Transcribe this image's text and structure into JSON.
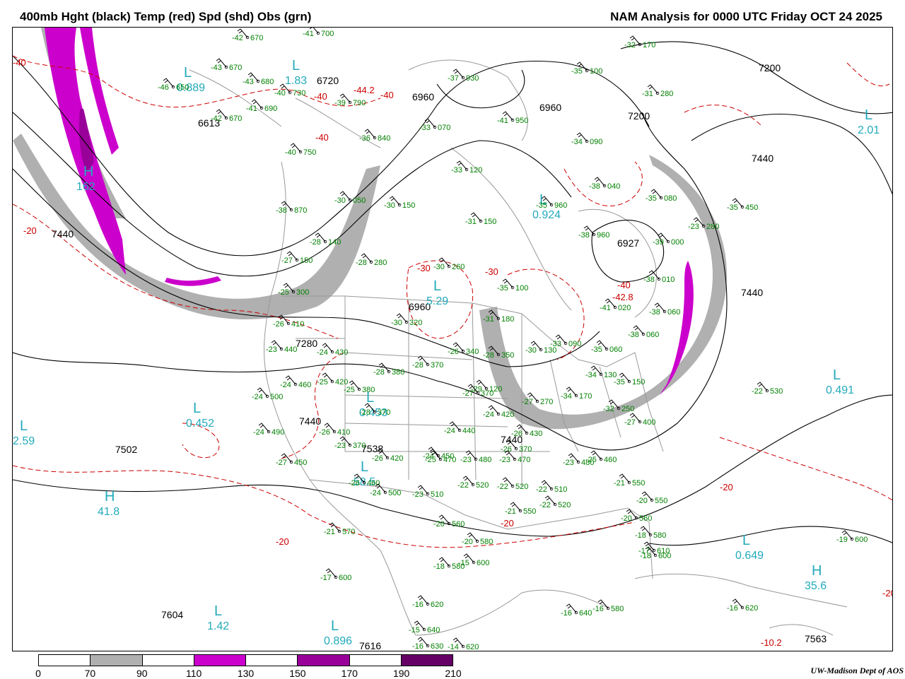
{
  "header": {
    "left_title": "400mb Hght (black) Temp (red) Spd (shd) Obs (grn)",
    "right_title": "NAM Analysis for 0000 UTC Friday  OCT 24 2025"
  },
  "colors": {
    "height": "#000000",
    "temp": "#cc0000",
    "obs": "#008000",
    "pressure_center": "#22aabb",
    "borders": "#999999"
  },
  "colorbar": {
    "labels": [
      "0",
      "70",
      "90",
      "110",
      "130",
      "150",
      "170",
      "190",
      "210"
    ],
    "colors": [
      "#ffffff",
      "#b0b0b0",
      "#ffffff",
      "#cc00cc",
      "#ffffff",
      "#990099",
      "#ffffff",
      "#660066"
    ]
  },
  "height_labels": [
    "7200",
    "7200",
    "7440",
    "7440",
    "7440",
    "7440",
    "6960",
    "6960",
    "6720",
    "6613",
    "6927",
    "6960",
    "7280",
    "7440",
    "7502",
    "7538",
    "7604",
    "7616",
    "7563",
    "7440"
  ],
  "temp_labels": [
    "-40",
    "-40",
    "-40",
    "-40",
    "-20",
    "-20",
    "-30",
    "-30",
    "-44.2",
    "-40",
    "-42.8",
    "-20",
    "-20",
    "-20",
    "-10.2"
  ],
  "centers": [
    {
      "type": "H",
      "value": "41.8"
    },
    {
      "type": "H",
      "value": "35.6"
    },
    {
      "type": "H",
      "value": "162"
    },
    {
      "type": "L",
      "value": "0.889"
    },
    {
      "type": "L",
      "value": "1.83"
    },
    {
      "type": "L",
      "value": "2.01"
    },
    {
      "type": "L",
      "value": "0.924"
    },
    {
      "type": "L",
      "value": "5.29"
    },
    {
      "type": "L",
      "value": "0.453"
    },
    {
      "type": "L",
      "value": "0.452"
    },
    {
      "type": "L",
      "value": "0.491"
    },
    {
      "type": "L",
      "value": "0.649"
    },
    {
      "type": "L",
      "value": "1.42"
    },
    {
      "type": "L",
      "value": "0.896"
    },
    {
      "type": "L",
      "value": "58.5"
    },
    {
      "type": "L",
      "value": "2.59"
    }
  ],
  "observations": [
    {
      "temp": "-42",
      "hght": "670"
    },
    {
      "temp": "-41",
      "hght": "700"
    },
    {
      "temp": "-43",
      "hght": "670"
    },
    {
      "temp": "-43",
      "hght": "680"
    },
    {
      "temp": "-46",
      "hght": "650"
    },
    {
      "temp": "-40",
      "hght": "730"
    },
    {
      "temp": "-41",
      "hght": "690"
    },
    {
      "temp": "-42",
      "hght": "670"
    },
    {
      "temp": "-39",
      "hght": "790"
    },
    {
      "temp": "-37",
      "hght": "930"
    },
    {
      "temp": "-35",
      "hght": "100"
    },
    {
      "temp": "-32",
      "hght": "170"
    },
    {
      "temp": "-31",
      "hght": "280"
    },
    {
      "temp": "-33",
      "hght": "070"
    },
    {
      "temp": "-41",
      "hght": "950"
    },
    {
      "temp": "-34",
      "hght": "090"
    },
    {
      "temp": "-36",
      "hght": "840"
    },
    {
      "temp": "-40",
      "hght": "750"
    },
    {
      "temp": "-33",
      "hght": "120"
    },
    {
      "temp": "-38",
      "hght": "040"
    },
    {
      "temp": "-35",
      "hght": "080"
    },
    {
      "temp": "-35",
      "hght": "450"
    },
    {
      "temp": "-30",
      "hght": "050"
    },
    {
      "temp": "-38",
      "hght": "870"
    },
    {
      "temp": "-30",
      "hght": "150"
    },
    {
      "temp": "-35",
      "hght": "960"
    },
    {
      "temp": "-31",
      "hght": "150"
    },
    {
      "temp": "-38",
      "hght": "960"
    },
    {
      "temp": "-39",
      "hght": "000"
    },
    {
      "temp": "-23",
      "hght": "280"
    },
    {
      "temp": "-28",
      "hght": "140"
    },
    {
      "temp": "-28",
      "hght": "280"
    },
    {
      "temp": "-27",
      "hght": "150"
    },
    {
      "temp": "-30",
      "hght": "260"
    },
    {
      "temp": "-35",
      "hght": "100"
    },
    {
      "temp": "-38",
      "hght": "010"
    },
    {
      "temp": "-25",
      "hght": "300"
    },
    {
      "temp": "-41",
      "hght": "020"
    },
    {
      "temp": "-38",
      "hght": "060"
    },
    {
      "temp": "-26",
      "hght": "410"
    },
    {
      "temp": "-30",
      "hght": "320"
    },
    {
      "temp": "-31",
      "hght": "180"
    },
    {
      "temp": "-38",
      "hght": "060"
    },
    {
      "temp": "-23",
      "hght": "440"
    },
    {
      "temp": "-24",
      "hght": "430"
    },
    {
      "temp": "-26",
      "hght": "340"
    },
    {
      "temp": "-28",
      "hght": "350"
    },
    {
      "temp": "-30",
      "hght": "130"
    },
    {
      "temp": "-33",
      "hght": "090"
    },
    {
      "temp": "-35",
      "hght": "060"
    },
    {
      "temp": "-28",
      "hght": "370"
    },
    {
      "temp": "-28",
      "hght": "380"
    },
    {
      "temp": "-29",
      "hght": "120"
    },
    {
      "temp": "-34",
      "hght": "130"
    },
    {
      "temp": "-35",
      "hght": "150"
    },
    {
      "temp": "-22",
      "hght": "530"
    },
    {
      "temp": "-24",
      "hght": "460"
    },
    {
      "temp": "-25",
      "hght": "420"
    },
    {
      "temp": "-25",
      "hght": "380"
    },
    {
      "temp": "-27",
      "hght": "370"
    },
    {
      "temp": "-32",
      "hght": "250"
    },
    {
      "temp": "-27",
      "hght": "270"
    },
    {
      "temp": "-34",
      "hght": "170"
    },
    {
      "temp": "-24",
      "hght": "500"
    },
    {
      "temp": "-28",
      "hght": "370"
    },
    {
      "temp": "-24",
      "hght": "420"
    },
    {
      "temp": "-24",
      "hght": "440"
    },
    {
      "temp": "-26",
      "hght": "430"
    },
    {
      "temp": "-27",
      "hght": "400"
    },
    {
      "temp": "-24",
      "hght": "490"
    },
    {
      "temp": "-26",
      "hght": "410"
    },
    {
      "temp": "-23",
      "hght": "370"
    },
    {
      "temp": "-26",
      "hght": "370"
    },
    {
      "temp": "-24",
      "hght": "450"
    },
    {
      "temp": "-27",
      "hght": "450"
    },
    {
      "temp": "-26",
      "hght": "420"
    },
    {
      "temp": "-25",
      "hght": "470"
    },
    {
      "temp": "-23",
      "hght": "480"
    },
    {
      "temp": "-23",
      "hght": "470"
    },
    {
      "temp": "-23",
      "hght": "480"
    },
    {
      "temp": "-25",
      "hght": "460"
    },
    {
      "temp": "-26",
      "hght": "460"
    },
    {
      "temp": "-24",
      "hght": "500"
    },
    {
      "temp": "-23",
      "hght": "510"
    },
    {
      "temp": "-22",
      "hght": "520"
    },
    {
      "temp": "-22",
      "hght": "520"
    },
    {
      "temp": "-22",
      "hght": "510"
    },
    {
      "temp": "-21",
      "hght": "550"
    },
    {
      "temp": "-22",
      "hght": "520"
    },
    {
      "temp": "-21",
      "hght": "550"
    },
    {
      "temp": "-20",
      "hght": "550"
    },
    {
      "temp": "-21",
      "hght": "570"
    },
    {
      "temp": "-20",
      "hght": "560"
    },
    {
      "temp": "-20",
      "hght": "560"
    },
    {
      "temp": "-18",
      "hght": "580"
    },
    {
      "temp": "-20",
      "hght": "580"
    },
    {
      "temp": "-18",
      "hght": "600"
    },
    {
      "temp": "-19",
      "hght": "600"
    },
    {
      "temp": "-18",
      "hght": "580"
    },
    {
      "temp": "-15",
      "hght": "600"
    },
    {
      "temp": "-17",
      "hght": "610"
    },
    {
      "temp": "-17",
      "hght": "600"
    },
    {
      "temp": "-16",
      "hght": "620"
    },
    {
      "temp": "-15",
      "hght": "640"
    },
    {
      "temp": "-16",
      "hght": "640"
    },
    {
      "temp": "-16",
      "hght": "580"
    },
    {
      "temp": "-16",
      "hght": "620"
    },
    {
      "temp": "-16",
      "hght": "630"
    },
    {
      "temp": "-14",
      "hght": "620"
    }
  ],
  "credit": "UW-Madison  Dept of AOS"
}
